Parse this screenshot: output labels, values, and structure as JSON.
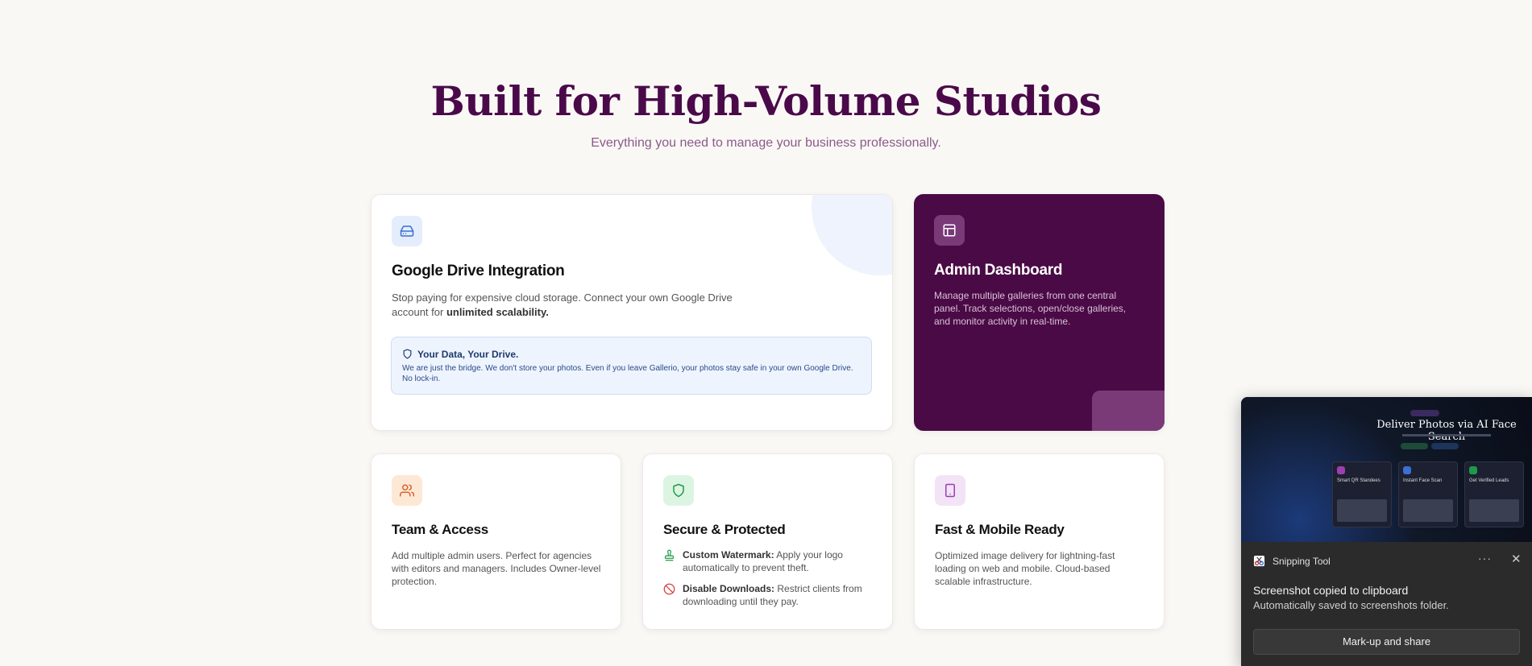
{
  "header": {
    "title": "Built for High-Volume Studios",
    "subtitle": "Everything you need to manage your business professionally."
  },
  "drive_card": {
    "icon": "hard-drive-icon",
    "title": "Google Drive Integration",
    "text": "Stop paying for expensive cloud storage. Connect your own Google Drive account for",
    "text_bold": "unlimited scalability.",
    "info_title": "Your Data, Your Drive.",
    "info_text": "We are just the bridge. We don't store your photos. Even if you leave Gallerio, your photos stay safe in your own Google Drive. No lock-in."
  },
  "admin_card": {
    "icon": "layout-icon",
    "title": "Admin Dashboard",
    "text": "Manage multiple galleries from one central panel. Track selections, open/close galleries, and monitor activity in real-time."
  },
  "team_card": {
    "icon": "users-icon",
    "title": "Team & Access",
    "text": "Add multiple admin users. Perfect for agencies with editors and managers. Includes Owner-level protection."
  },
  "secure_card": {
    "icon": "shield-icon",
    "title": "Secure & Protected",
    "feature1_bold": "Custom Watermark:",
    "feature1_text": "Apply your logo automatically to prevent theft.",
    "feature2_bold": "Disable Downloads:",
    "feature2_text": "Restrict clients from downloading until they pay."
  },
  "mobile_card": {
    "icon": "smartphone-icon",
    "title": "Fast & Mobile Ready",
    "text": "Optimized image delivery for lightning-fast loading on web and mobile. Cloud-based scalable infrastructure."
  },
  "toast": {
    "app_name": "Snipping Tool",
    "more_label": "···",
    "close_label": "✕",
    "message": "Screenshot copied to clipboard",
    "detail": "Automatically saved to screenshots folder.",
    "button_label": "Mark-up and share",
    "preview": {
      "title": "Deliver Photos via AI Face Search",
      "cards": [
        "Smart QR Standees",
        "Instant Face Scan",
        "Get Verified Leads"
      ]
    }
  },
  "colors": {
    "brand": "#4a0a45",
    "background": "#faf8f5",
    "drive_icon_bg": "#e3edfc",
    "team_icon_bg": "#fde8d6",
    "secure_icon_bg": "#dcf5e3",
    "mobile_icon_bg": "#f3e3f7"
  }
}
